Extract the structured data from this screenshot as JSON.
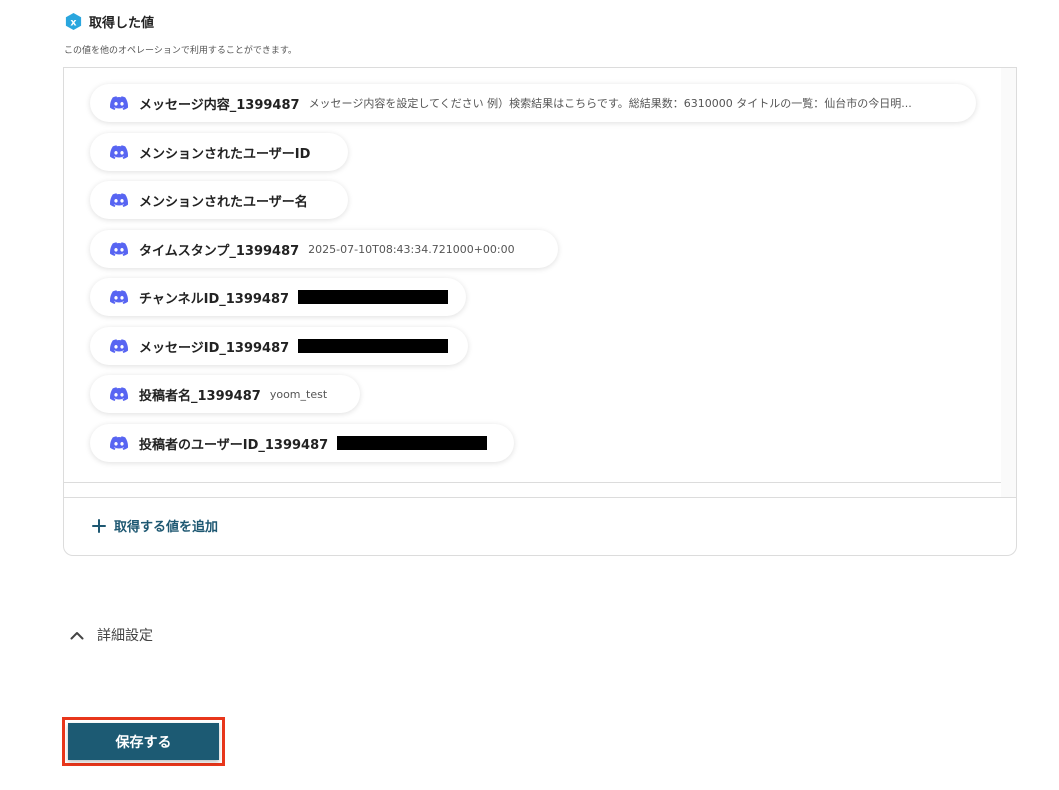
{
  "section": {
    "title": "取得した値",
    "description": "この値を他のオペレーションで利用することができます。",
    "icon": "x-hexagon-icon"
  },
  "colors": {
    "discord": "#5865F2",
    "accent": "#1e5872",
    "save_bg": "#1c5a73",
    "highlight": "#e8361b"
  },
  "values": [
    {
      "label": "メッセージ内容_1399487",
      "value": "メッセージ内容を設定してください 例）検索結果はこちらです。総結果数：6310000 タイトルの一覧：仙台市の今日明...",
      "redacted": false
    },
    {
      "label": "メンションされたユーザーID",
      "value": "",
      "redacted": false
    },
    {
      "label": "メンションされたユーザー名",
      "value": "",
      "redacted": false
    },
    {
      "label": "タイムスタンプ_1399487",
      "value": "2025-07-10T08:43:34.721000+00:00",
      "redacted": false
    },
    {
      "label": "チャンネルID_1399487",
      "value": "",
      "redacted": true
    },
    {
      "label": "メッセージID_1399487",
      "value": "",
      "redacted": true
    },
    {
      "label": "投稿者名_1399487",
      "value": "yoom_test",
      "redacted": false
    },
    {
      "label": "投稿者のユーザーID_1399487",
      "value": "",
      "redacted": true
    }
  ],
  "add_value_label": "取得する値を追加",
  "detail_settings_label": "詳細設定",
  "save_label": "保存する"
}
